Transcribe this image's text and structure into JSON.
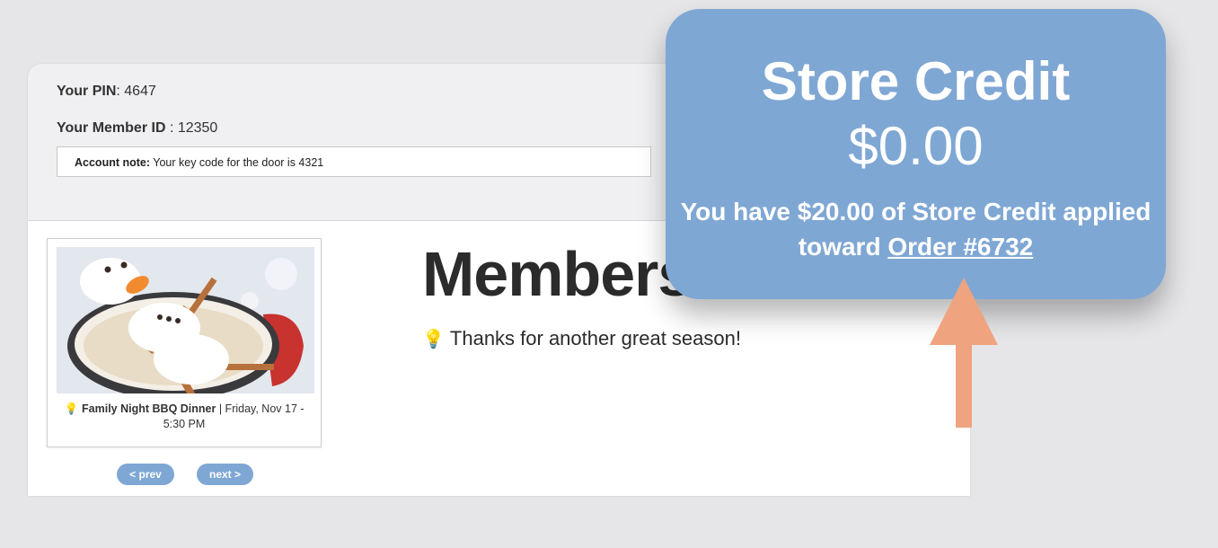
{
  "account": {
    "pin_label": "Your PIN",
    "pin_value": ": 4647",
    "member_id_label": "Your Member ID",
    "member_id_value": " : 12350",
    "note_label": "Account note:",
    "note_text": " Your key code for the door is 4321"
  },
  "event": {
    "title": "Family Night BBQ Dinner",
    "date": " | Friday, Nov 17 - 5:30 PM",
    "image_icon": "snowman-marshmallow-cocoa-image"
  },
  "pager": {
    "prev_label": "< prev",
    "next_label": "next >"
  },
  "main": {
    "title": "Members",
    "message": "Thanks for another great season!"
  },
  "store_credit": {
    "title": "Store Credit",
    "amount": "$0.00",
    "message_prefix": "You have $20.00 of Store Credit applied toward ",
    "order_link": "Order #6732"
  },
  "colors": {
    "accent": "#7fa7d4",
    "arrow": "#f0a37f",
    "header_bg": "#f0f0f2"
  }
}
